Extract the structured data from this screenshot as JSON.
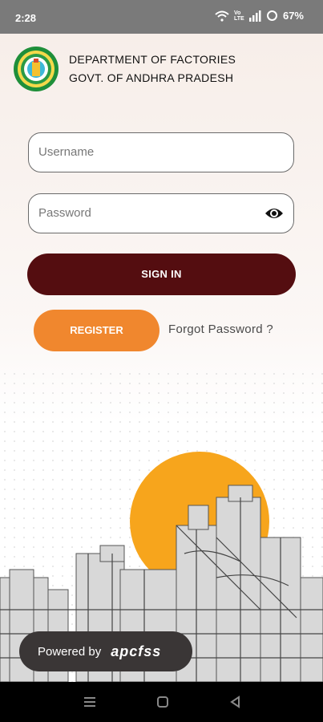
{
  "status_bar": {
    "time": "2:28",
    "battery": "67%",
    "network_label": "Vo LTE"
  },
  "header": {
    "line1": "DEPARTMENT OF FACTORIES",
    "line2": "GOVT. OF ANDHRA PRADESH"
  },
  "form": {
    "username_placeholder": "Username",
    "password_placeholder": "Password",
    "signin_label": "SIGN IN",
    "register_label": "REGISTER",
    "forgot_label": "Forgot Password ?"
  },
  "footer": {
    "powered_by": "Powered by",
    "brand": "apcfss"
  },
  "colors": {
    "signin": "#540d10",
    "register": "#f0872e",
    "sun": "#f7a51c",
    "powered_bg": "#3a3636"
  },
  "icons": [
    "wifi-icon",
    "signal-icon",
    "battery-icon",
    "emblem-logo",
    "eye-icon",
    "menu-nav-icon",
    "home-nav-icon",
    "back-nav-icon"
  ]
}
